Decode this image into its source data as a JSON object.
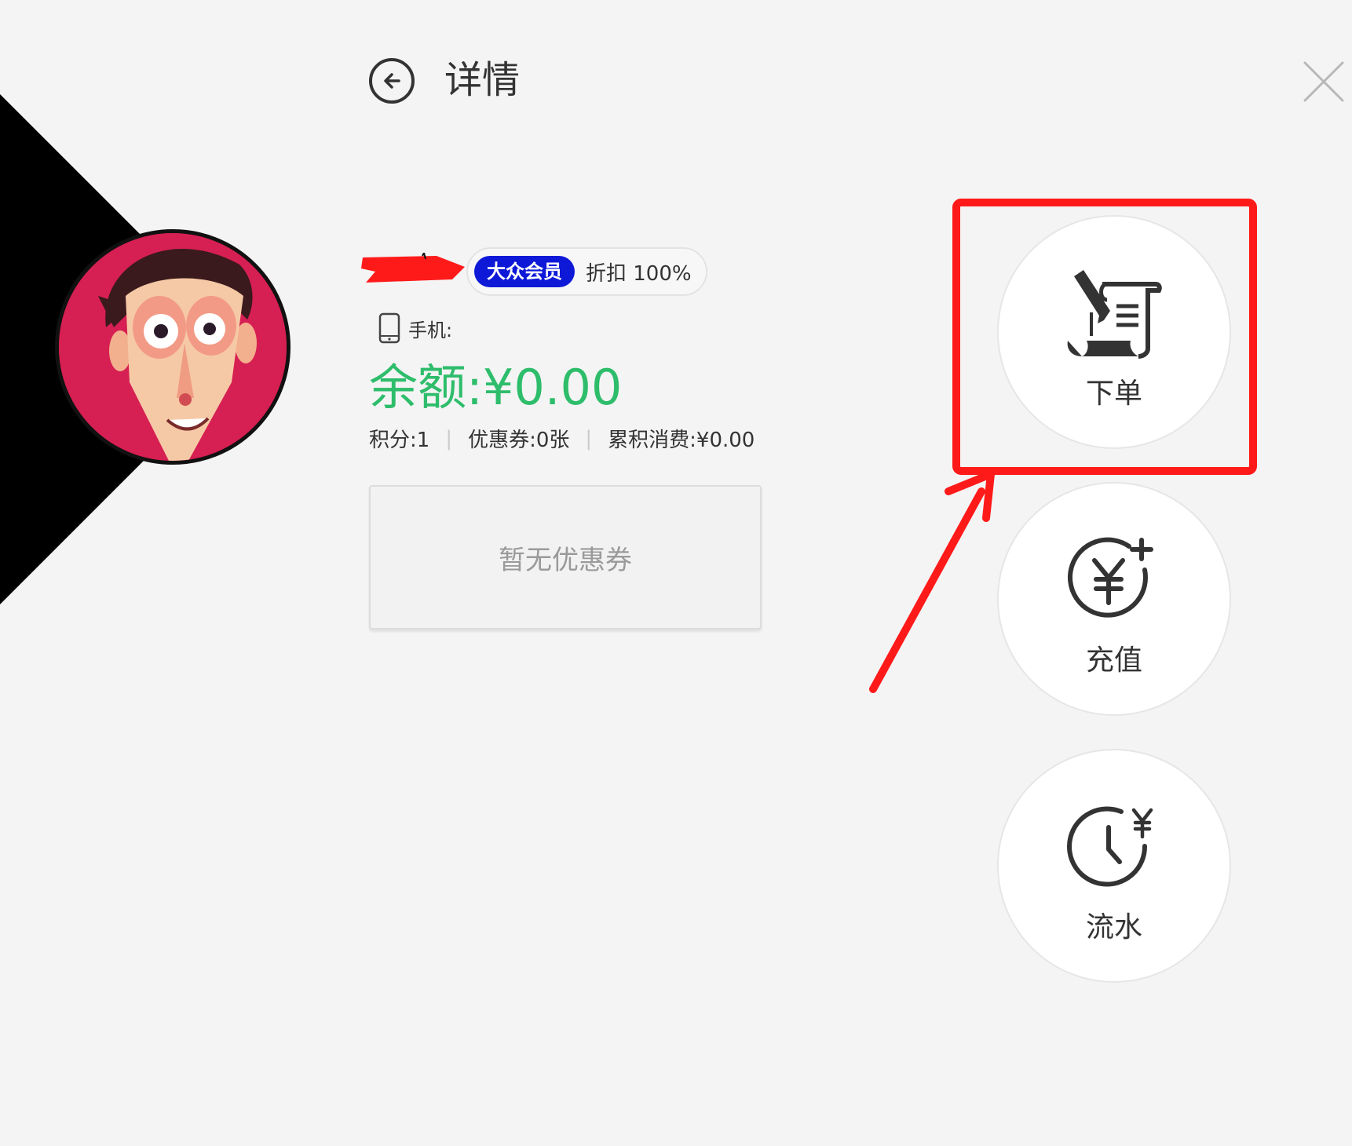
{
  "header": {
    "title": "详情"
  },
  "member": {
    "level_badge": "大众会员",
    "discount": "折扣 100%",
    "phone_label": "手机:",
    "balance": "余额:¥0.00",
    "points": "积分:1",
    "coupons": "优惠券:0张",
    "total_spend": "累积消费:¥0.00",
    "coupon_empty": "暂无优惠券"
  },
  "actions": [
    {
      "label": "下单",
      "icon": "order-scroll-pen-icon"
    },
    {
      "label": "充值",
      "icon": "yuan-plus-icon"
    },
    {
      "label": "流水",
      "icon": "clock-yuan-icon"
    }
  ],
  "colors": {
    "balance": "#2ebd6b",
    "badge": "#0e19d8",
    "annotation": "#ff1a1a",
    "background": "#f4f4f4"
  }
}
